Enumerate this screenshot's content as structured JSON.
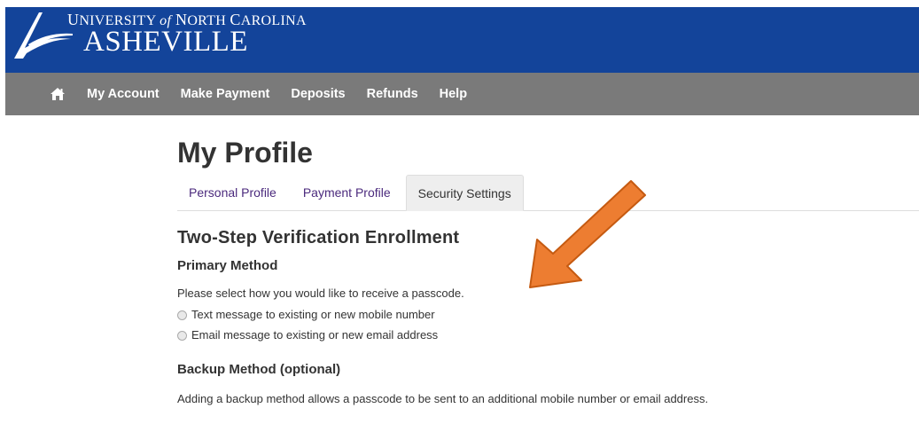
{
  "header": {
    "logo_line1_part1": "U",
    "logo_line1_part2": "NIVERSITY ",
    "logo_line1_of": "of",
    "logo_line1_part3": " N",
    "logo_line1_part4": "ORTH ",
    "logo_line1_part5": "C",
    "logo_line1_part6": "AROLINA",
    "logo_line2": "ASHEVILLE",
    "bg_color": "#13449a"
  },
  "nav": {
    "home_icon": "home-icon",
    "items": [
      {
        "label": "My Account"
      },
      {
        "label": "Make Payment"
      },
      {
        "label": "Deposits"
      },
      {
        "label": "Refunds"
      },
      {
        "label": "Help"
      }
    ],
    "bg_color": "#7a7a7a"
  },
  "main": {
    "title": "My Profile",
    "tabs": [
      {
        "label": "Personal Profile",
        "active": false
      },
      {
        "label": "Payment Profile",
        "active": false
      },
      {
        "label": "Security Settings",
        "active": true
      }
    ],
    "section_title": "Two-Step Verification Enrollment",
    "primary": {
      "title": "Primary Method",
      "instruction": "Please select how you would like to receive a passcode.",
      "options": [
        {
          "label": "Text message to existing or new mobile number",
          "selected": false
        },
        {
          "label": "Email message to existing or new email address",
          "selected": false
        }
      ]
    },
    "backup": {
      "title": "Backup Method (optional)",
      "text": "Adding a backup method allows a passcode to be sent to an additional mobile number or email address."
    }
  },
  "annotation": {
    "arrow_color": "#ed7d31",
    "arrow_icon": "orange-arrow-annotation"
  }
}
